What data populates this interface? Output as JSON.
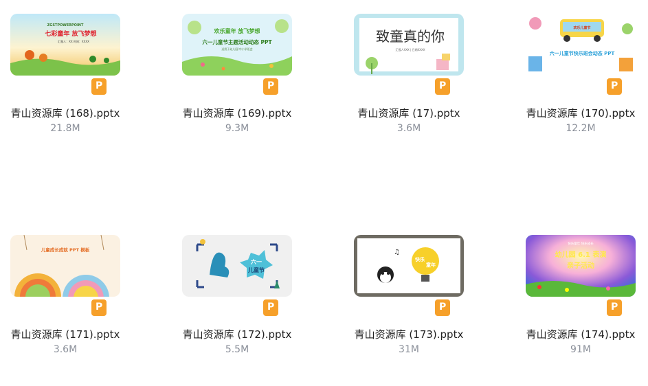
{
  "files": [
    {
      "name": "青山资源库 (168).pptx",
      "size": "21.8M",
      "thumb_text": [
        "ZGSTPOWERPOINT",
        "七彩童年 放飞梦想",
        "汇报人：XX  时间：XXXX"
      ]
    },
    {
      "name": "青山资源库 (169).pptx",
      "size": "9.3M",
      "thumb_text": [
        "欢乐童年 放飞梦想",
        "六一儿童节主题活动动态 PPT",
        "适用于幼儿园/中小学班会"
      ]
    },
    {
      "name": "青山资源库 (17).pptx",
      "size": "3.6M",
      "thumb_text": [
        "致童真的你",
        "汇报人XXX | 日期XXXX"
      ]
    },
    {
      "name": "青山资源库 (170).pptx",
      "size": "12.2M",
      "thumb_text": [
        "欢乐儿童节",
        "六一儿童节快乐班会动态 PPT"
      ]
    },
    {
      "name": "青山资源库 (171).pptx",
      "size": "3.6M",
      "thumb_text": [
        "儿童成长成就 PPT 模板"
      ]
    },
    {
      "name": "青山资源库 (172).pptx",
      "size": "5.5M",
      "thumb_text": [
        "六一",
        "儿童节"
      ]
    },
    {
      "name": "青山资源库 (173).pptx",
      "size": "31M",
      "thumb_text": [
        "快乐",
        "童年"
      ]
    },
    {
      "name": "青山资源库 (174).pptx",
      "size": "91M",
      "thumb_text": [
        "快乐童年 快乐成长",
        "幼儿园 6.1 表演",
        "亲子活动"
      ]
    }
  ],
  "icons": {
    "file_type": "ppt-file-icon",
    "badge_letter": "P"
  },
  "colors": {
    "badge": "#f6a02a",
    "size_text": "#8a8f99",
    "name_text": "#222222"
  }
}
